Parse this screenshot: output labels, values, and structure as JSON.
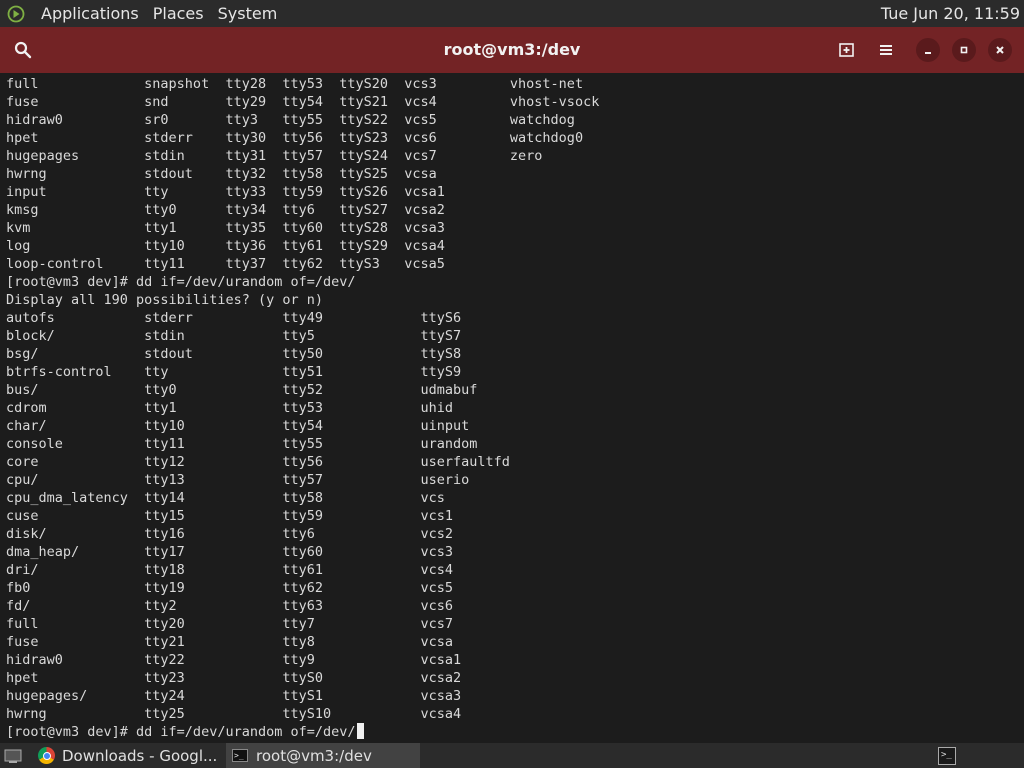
{
  "topbar": {
    "menus": [
      "Applications",
      "Places",
      "System"
    ],
    "clock": "Tue Jun 20, 11:59",
    "logo_icon": "activities-icon"
  },
  "window": {
    "title": "root@vm3:/dev",
    "accent_color": "#732325",
    "buttons": [
      "search-icon",
      "new-tab-icon",
      "hamburger-menu-icon",
      "minimize-icon",
      "maximize-icon",
      "close-icon"
    ]
  },
  "terminal": {
    "lines": [
      "full             snapshot  tty28  tty53  ttyS20  vcs3         vhost-net",
      "fuse             snd       tty29  tty54  ttyS21  vcs4         vhost-vsock",
      "hidraw0          sr0       tty3   tty55  ttyS22  vcs5         watchdog",
      "hpet             stderr    tty30  tty56  ttyS23  vcs6         watchdog0",
      "hugepages        stdin     tty31  tty57  ttyS24  vcs7         zero",
      "hwrng            stdout    tty32  tty58  ttyS25  vcsa",
      "input            tty       tty33  tty59  ttyS26  vcsa1",
      "kmsg             tty0      tty34  tty6   ttyS27  vcsa2",
      "kvm              tty1      tty35  tty60  ttyS28  vcsa3",
      "log              tty10     tty36  tty61  ttyS29  vcsa4",
      "loop-control     tty11     tty37  tty62  ttyS3   vcsa5",
      "[root@vm3 dev]# dd if=/dev/urandom of=/dev/",
      "Display all 190 possibilities? (y or n)",
      "autofs           stderr           tty49            ttyS6",
      "block/           stdin            tty5             ttyS7",
      "bsg/             stdout           tty50            ttyS8",
      "btrfs-control    tty              tty51            ttyS9",
      "bus/             tty0             tty52            udmabuf",
      "cdrom            tty1             tty53            uhid",
      "char/            tty10            tty54            uinput",
      "console          tty11            tty55            urandom",
      "core             tty12            tty56            userfaultfd",
      "cpu/             tty13            tty57            userio",
      "cpu_dma_latency  tty14            tty58            vcs",
      "cuse             tty15            tty59            vcs1",
      "disk/            tty16            tty6             vcs2",
      "dma_heap/        tty17            tty60            vcs3",
      "dri/             tty18            tty61            vcs4",
      "fb0              tty19            tty62            vcs5",
      "fd/              tty2             tty63            vcs6",
      "full             tty20            tty7             vcs7",
      "fuse             tty21            tty8             vcsa",
      "hidraw0          tty22            tty9             vcsa1",
      "hpet             tty23            ttyS0            vcsa2",
      "hugepages/       tty24            ttyS1            vcsa3",
      "hwrng            tty25            ttyS10           vcsa4"
    ],
    "prompt_line": "[root@vm3 dev]# dd if=/dev/urandom of=/dev/",
    "background": "#1c1c1c",
    "foreground": "#d9d9d9"
  },
  "taskbar": {
    "tasks": [
      {
        "label": "Downloads - Googl...",
        "icon": "chrome-icon"
      },
      {
        "label": "root@vm3:/dev",
        "icon": "terminal-icon",
        "active": true
      }
    ],
    "desktop_icon": "show-desktop-icon",
    "workspace_icon": "workspace-switcher-icon"
  }
}
